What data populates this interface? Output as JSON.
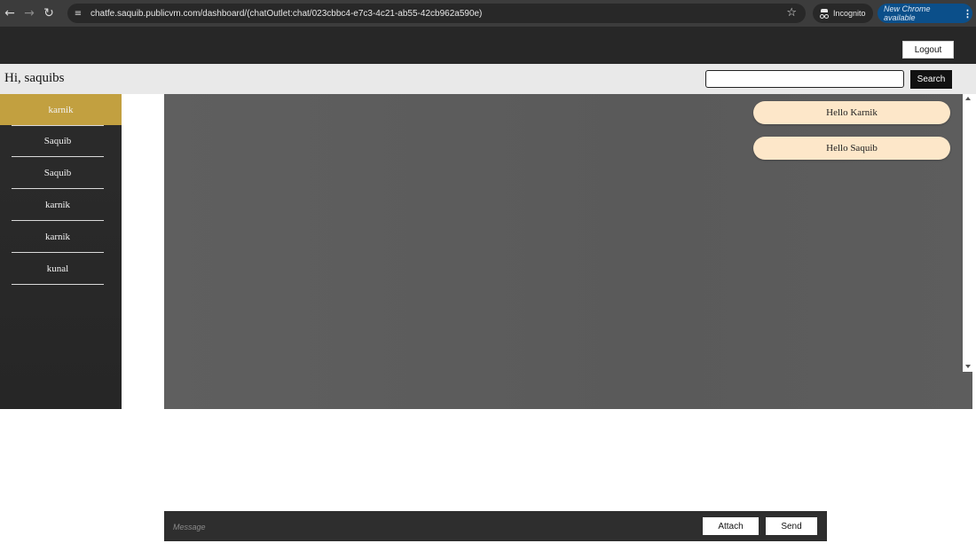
{
  "browser": {
    "url": "chatfe.saquib.publicvm.com/dashboard/(chatOutlet:chat/023cbbc4-e7c3-4c21-ab55-42cb962a590e)",
    "incognito_label": "Incognito",
    "update_label": "New Chrome available",
    "icons": [
      "back-arrow-icon",
      "forward-arrow-icon",
      "reload-icon",
      "site-settings-icon",
      "star-icon",
      "incognito-icon",
      "kebab-menu-icon"
    ]
  },
  "header": {
    "logout_label": "Logout",
    "greeting": "Hi, saquibs",
    "search_placeholder": "",
    "search_label": "Search"
  },
  "sidebar": {
    "contacts": [
      {
        "name": "karnik",
        "active": true
      },
      {
        "name": "Saquib",
        "active": false
      },
      {
        "name": "Saquib",
        "active": false
      },
      {
        "name": "karnik",
        "active": false
      },
      {
        "name": "karnik",
        "active": false
      },
      {
        "name": "kunal",
        "active": false
      }
    ]
  },
  "chat": {
    "messages": [
      {
        "text": "Hello Karnik"
      },
      {
        "text": "Hello Saquib"
      }
    ]
  },
  "composer": {
    "placeholder": "Message",
    "attach_label": "Attach",
    "send_label": "Send"
  },
  "colors": {
    "active_contact": "#c2a040",
    "bubble": "#fde7c9",
    "chat_background": "#5e5e5e",
    "sidebar": "#292929"
  }
}
